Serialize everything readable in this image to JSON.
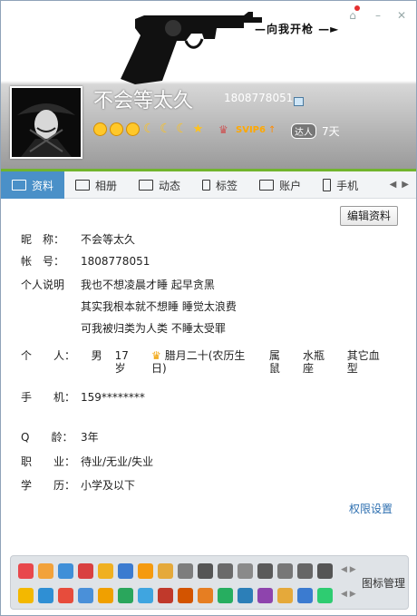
{
  "header": {
    "slogan": "—向我开枪 —►",
    "nickname": "不会等太久",
    "qq_number": "1808778051",
    "svip_label": "SVIP6",
    "daren_label": "达人",
    "daren_days": "7天"
  },
  "tabs": [
    {
      "label": "资料",
      "icon": "profile-card-icon"
    },
    {
      "label": "相册",
      "icon": "album-icon"
    },
    {
      "label": "动态",
      "icon": "feed-icon"
    },
    {
      "label": "标签",
      "icon": "bookmark-icon"
    },
    {
      "label": "账户",
      "icon": "wallet-icon"
    },
    {
      "label": "手机",
      "icon": "phone-icon"
    }
  ],
  "edit_button": "编辑资料",
  "profile": {
    "nickname_label": "昵　称：",
    "nickname": "不会等太久",
    "account_label": "帐　号：",
    "account": "1808778051",
    "desc_label": "个人说明",
    "desc_lines": [
      "我也不想凌晨才睡 起早贪黑",
      "其实我根本就不想睡 睡觉太浪费",
      "可我被归类为人类 不睡太受罪"
    ],
    "personal_label": "个　　人：",
    "gender": "男",
    "age": "17岁",
    "birthday": "腊月二十(农历生日)",
    "zodiac": "属鼠",
    "constellation": "水瓶座",
    "blood": "其它血型",
    "phone_label": "手　　机：",
    "phone": "159********",
    "qage_label": "Q　　龄：",
    "qage": "3年",
    "job_label": "职　　业：",
    "job": "待业/无业/失业",
    "edu_label": "学　　历：",
    "edu": "小学及以下"
  },
  "permission_link": "权限设置",
  "icon_manager": "图标管理",
  "icon_colors_row1": [
    "#e8484c",
    "#f2a23a",
    "#3f8fd8",
    "#d94040",
    "#f0b020",
    "#3b7bd0",
    "#f59a0f",
    "#e5a93a",
    "#7d7d7d",
    "#555555",
    "#6a6a6a",
    "#8a8a8a",
    "#5a5a5a",
    "#777777",
    "#666666",
    "#555555"
  ],
  "icon_colors_row2": [
    "#f3b800",
    "#2f8fd4",
    "#e74c3c",
    "#4a90d9",
    "#f0a000",
    "#2aa65c",
    "#3fa5e0",
    "#c0392b",
    "#d35400",
    "#e67e22",
    "#27ae60",
    "#2c7fb8",
    "#8e44ad",
    "#e5a93a",
    "#3b7bd0",
    "#2ecc71"
  ]
}
